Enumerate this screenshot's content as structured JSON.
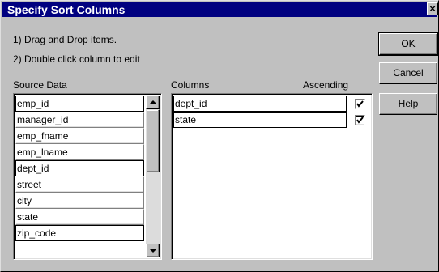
{
  "dialog": {
    "title": "Specify Sort Columns",
    "close_label": "×"
  },
  "instructions": {
    "line1": "1) Drag and Drop items.",
    "line2": "2) Double click column to edit"
  },
  "buttons": {
    "ok": "OK",
    "cancel": "Cancel",
    "help_mnemonic": "H",
    "help_rest": "elp"
  },
  "source": {
    "label": "Source Data",
    "items": [
      "emp_id",
      "manager_id",
      "emp_fname",
      "emp_lname",
      "dept_id",
      "street",
      "city",
      "state",
      "zip_code"
    ]
  },
  "columns": {
    "label": "Columns",
    "ascending_label": "Ascending",
    "items": [
      {
        "name": "dept_id",
        "ascending": true
      },
      {
        "name": "state",
        "ascending": true
      }
    ]
  },
  "colors": {
    "titlebar": "#000080",
    "face": "#c0c0c0"
  }
}
